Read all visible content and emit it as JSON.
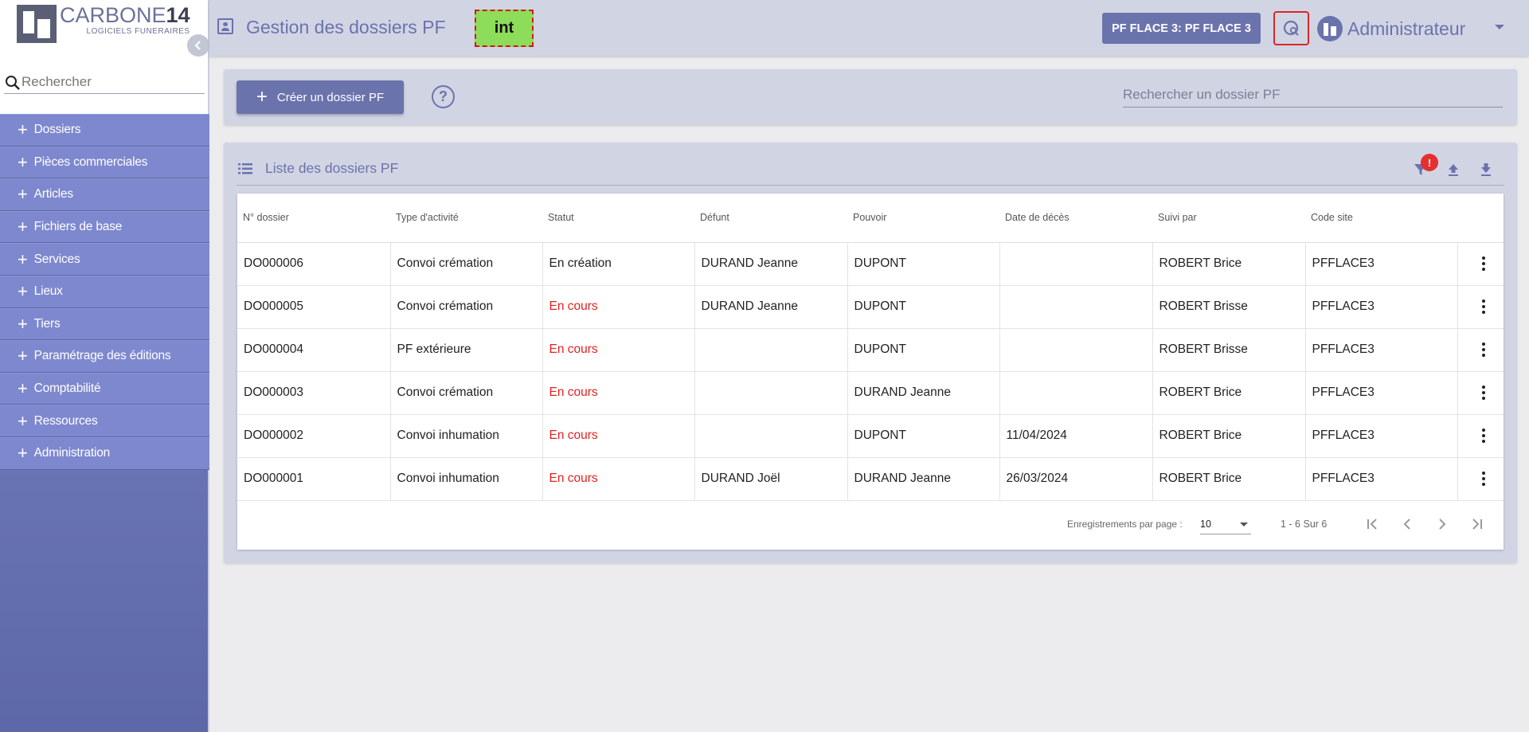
{
  "sidebar": {
    "logo_title_a": "CARBONE",
    "logo_title_b": "14",
    "logo_subtitle": "LOGICIELS FUNERAIRES",
    "search_placeholder": "Rechercher",
    "items": [
      {
        "label": "Dossiers"
      },
      {
        "label": "Pièces commerciales"
      },
      {
        "label": "Articles"
      },
      {
        "label": "Fichiers de base"
      },
      {
        "label": "Services"
      },
      {
        "label": "Lieux"
      },
      {
        "label": "Tiers"
      },
      {
        "label": "Paramétrage des éditions"
      },
      {
        "label": "Comptabilité"
      },
      {
        "label": "Ressources"
      },
      {
        "label": "Administration"
      }
    ]
  },
  "header": {
    "title": "Gestion des dossiers PF",
    "env_badge": "int",
    "site_button": "PF FLACE 3: PF FLACE 3",
    "user_name": "Administrateur"
  },
  "toolbar": {
    "create_label": "Créer un dossier PF",
    "help_glyph": "?",
    "search_placeholder": "Rechercher un dossier PF"
  },
  "list": {
    "title": "Liste des dossiers PF",
    "filter_badge": "!",
    "columns": [
      "N° dossier",
      "Type d'activité",
      "Statut",
      "Défunt",
      "Pouvoir",
      "Date de décès",
      "Suivi par",
      "Code site"
    ],
    "rows": [
      {
        "num": "DO000006",
        "type": "Convoi crémation",
        "statut": "En création",
        "defunt": "DURAND Jeanne",
        "pouvoir": "DUPONT",
        "date": "",
        "suivi": "ROBERT Brice",
        "site": "PFFLACE3"
      },
      {
        "num": "DO000005",
        "type": "Convoi crémation",
        "statut": "En cours",
        "defunt": "DURAND Jeanne",
        "pouvoir": "DUPONT",
        "date": "",
        "suivi": "ROBERT Brisse",
        "site": "PFFLACE3"
      },
      {
        "num": "DO000004",
        "type": "PF extérieure",
        "statut": "En cours",
        "defunt": "",
        "pouvoir": "DUPONT",
        "date": "",
        "suivi": "ROBERT Brisse",
        "site": "PFFLACE3"
      },
      {
        "num": "DO000003",
        "type": "Convoi crémation",
        "statut": "En cours",
        "defunt": "",
        "pouvoir": "DURAND Jeanne",
        "date": "",
        "suivi": "ROBERT Brice",
        "site": "PFFLACE3"
      },
      {
        "num": "DO000002",
        "type": "Convoi inhumation",
        "statut": "En cours",
        "defunt": "",
        "pouvoir": "DUPONT",
        "date": "11/04/2024",
        "suivi": "ROBERT Brice",
        "site": "PFFLACE3"
      },
      {
        "num": "DO000001",
        "type": "Convoi inhumation",
        "statut": "En cours",
        "defunt": "DURAND Joël",
        "pouvoir": "DURAND Jeanne",
        "date": "26/03/2024",
        "suivi": "ROBERT Brice",
        "site": "PFFLACE3"
      }
    ]
  },
  "pagination": {
    "per_page_label": "Enregistrements par page :",
    "per_page_value": "10",
    "range": "1 - 6 Sur 6"
  },
  "colors": {
    "accent": "#6b73ad",
    "menu_bg": "#7e88cf",
    "status_red": "#e0221f",
    "badge_green": "#8ddc5a"
  },
  "icons": {
    "search": "magnifier-icon",
    "filter": "filter-icon",
    "upload": "upload-icon",
    "download": "download-icon"
  }
}
